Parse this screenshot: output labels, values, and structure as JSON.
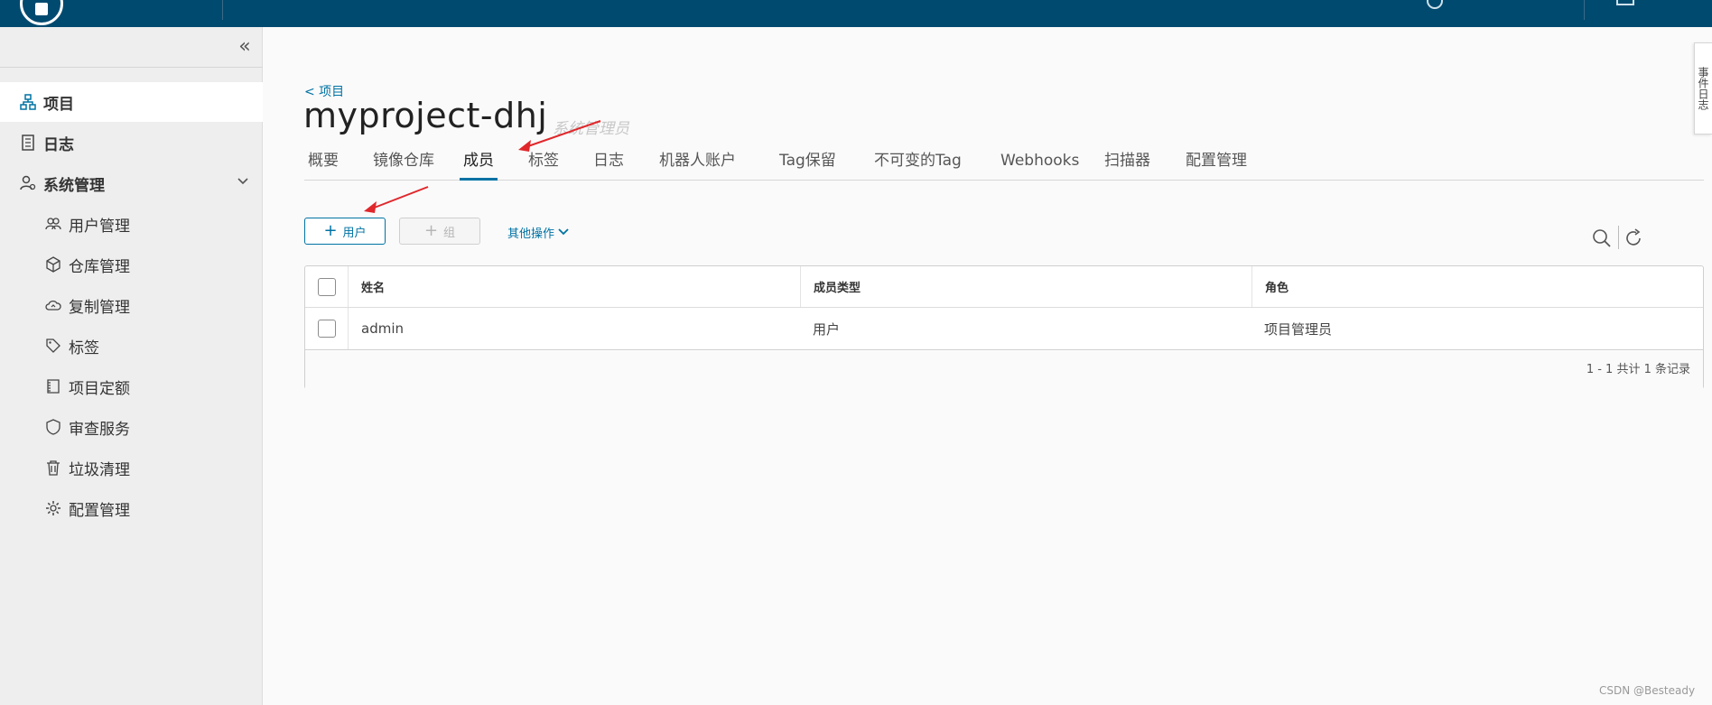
{
  "sidebar": {
    "items": [
      {
        "label": "项目",
        "icon": "project-icon"
      },
      {
        "label": "日志",
        "icon": "log-icon"
      },
      {
        "label": "系统管理",
        "icon": "system-admin-icon"
      }
    ],
    "sub_items": [
      {
        "label": "用户管理",
        "icon": "users-icon"
      },
      {
        "label": "仓库管理",
        "icon": "registry-icon"
      },
      {
        "label": "复制管理",
        "icon": "replication-icon"
      },
      {
        "label": "标签",
        "icon": "tag-icon"
      },
      {
        "label": "项目定额",
        "icon": "quota-icon"
      },
      {
        "label": "审查服务",
        "icon": "shield-icon"
      },
      {
        "label": "垃圾清理",
        "icon": "trash-icon"
      },
      {
        "label": "配置管理",
        "icon": "gear-icon"
      }
    ]
  },
  "breadcrumb": {
    "back_label": "< 项目"
  },
  "project": {
    "title": "myproject-dhj",
    "role": "系统管理员"
  },
  "tabs": [
    {
      "label": "概要"
    },
    {
      "label": "镜像仓库"
    },
    {
      "label": "成员",
      "active": true
    },
    {
      "label": "标签"
    },
    {
      "label": "日志"
    },
    {
      "label": "机器人账户"
    },
    {
      "label": "Tag保留"
    },
    {
      "label": "不可变的Tag"
    },
    {
      "label": "Webhooks"
    },
    {
      "label": "扫描器"
    },
    {
      "label": "配置管理"
    }
  ],
  "toolbar": {
    "add_user_label": "用户",
    "add_group_label": "组",
    "more_ops_label": "其他操作"
  },
  "table": {
    "columns": [
      "姓名",
      "成员类型",
      "角色"
    ],
    "rows": [
      {
        "name": "admin",
        "type": "用户",
        "role": "项目管理员"
      }
    ],
    "footer": "1 - 1 共计 1 条记录"
  },
  "right_tab": {
    "label": "事件日志"
  },
  "watermark": "CSDN @Besteady",
  "colors": {
    "header": "#004a70",
    "accent": "#0072a3",
    "annotation_arrow": "#e0272b"
  }
}
